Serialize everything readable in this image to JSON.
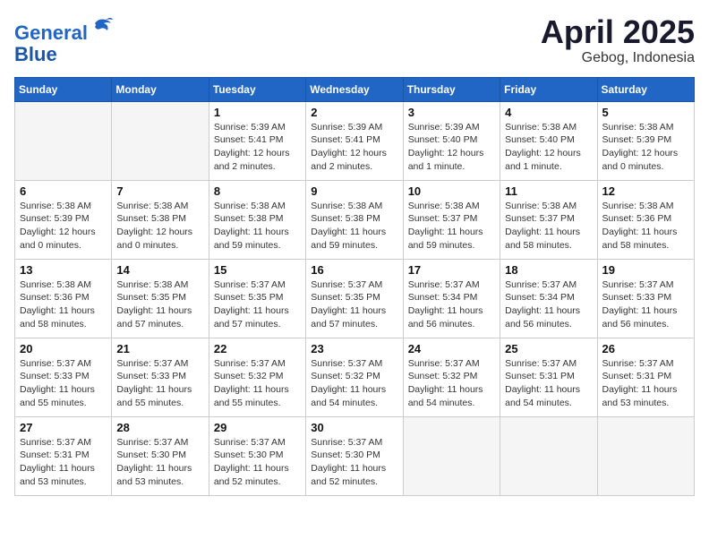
{
  "header": {
    "logo_line1": "General",
    "logo_line2": "Blue",
    "month": "April 2025",
    "location": "Gebog, Indonesia"
  },
  "weekdays": [
    "Sunday",
    "Monday",
    "Tuesday",
    "Wednesday",
    "Thursday",
    "Friday",
    "Saturday"
  ],
  "weeks": [
    [
      {
        "day": "",
        "info": ""
      },
      {
        "day": "",
        "info": ""
      },
      {
        "day": "1",
        "info": "Sunrise: 5:39 AM\nSunset: 5:41 PM\nDaylight: 12 hours\nand 2 minutes."
      },
      {
        "day": "2",
        "info": "Sunrise: 5:39 AM\nSunset: 5:41 PM\nDaylight: 12 hours\nand 2 minutes."
      },
      {
        "day": "3",
        "info": "Sunrise: 5:39 AM\nSunset: 5:40 PM\nDaylight: 12 hours\nand 1 minute."
      },
      {
        "day": "4",
        "info": "Sunrise: 5:38 AM\nSunset: 5:40 PM\nDaylight: 12 hours\nand 1 minute."
      },
      {
        "day": "5",
        "info": "Sunrise: 5:38 AM\nSunset: 5:39 PM\nDaylight: 12 hours\nand 0 minutes."
      }
    ],
    [
      {
        "day": "6",
        "info": "Sunrise: 5:38 AM\nSunset: 5:39 PM\nDaylight: 12 hours\nand 0 minutes."
      },
      {
        "day": "7",
        "info": "Sunrise: 5:38 AM\nSunset: 5:38 PM\nDaylight: 12 hours\nand 0 minutes."
      },
      {
        "day": "8",
        "info": "Sunrise: 5:38 AM\nSunset: 5:38 PM\nDaylight: 11 hours\nand 59 minutes."
      },
      {
        "day": "9",
        "info": "Sunrise: 5:38 AM\nSunset: 5:38 PM\nDaylight: 11 hours\nand 59 minutes."
      },
      {
        "day": "10",
        "info": "Sunrise: 5:38 AM\nSunset: 5:37 PM\nDaylight: 11 hours\nand 59 minutes."
      },
      {
        "day": "11",
        "info": "Sunrise: 5:38 AM\nSunset: 5:37 PM\nDaylight: 11 hours\nand 58 minutes."
      },
      {
        "day": "12",
        "info": "Sunrise: 5:38 AM\nSunset: 5:36 PM\nDaylight: 11 hours\nand 58 minutes."
      }
    ],
    [
      {
        "day": "13",
        "info": "Sunrise: 5:38 AM\nSunset: 5:36 PM\nDaylight: 11 hours\nand 58 minutes."
      },
      {
        "day": "14",
        "info": "Sunrise: 5:38 AM\nSunset: 5:35 PM\nDaylight: 11 hours\nand 57 minutes."
      },
      {
        "day": "15",
        "info": "Sunrise: 5:37 AM\nSunset: 5:35 PM\nDaylight: 11 hours\nand 57 minutes."
      },
      {
        "day": "16",
        "info": "Sunrise: 5:37 AM\nSunset: 5:35 PM\nDaylight: 11 hours\nand 57 minutes."
      },
      {
        "day": "17",
        "info": "Sunrise: 5:37 AM\nSunset: 5:34 PM\nDaylight: 11 hours\nand 56 minutes."
      },
      {
        "day": "18",
        "info": "Sunrise: 5:37 AM\nSunset: 5:34 PM\nDaylight: 11 hours\nand 56 minutes."
      },
      {
        "day": "19",
        "info": "Sunrise: 5:37 AM\nSunset: 5:33 PM\nDaylight: 11 hours\nand 56 minutes."
      }
    ],
    [
      {
        "day": "20",
        "info": "Sunrise: 5:37 AM\nSunset: 5:33 PM\nDaylight: 11 hours\nand 55 minutes."
      },
      {
        "day": "21",
        "info": "Sunrise: 5:37 AM\nSunset: 5:33 PM\nDaylight: 11 hours\nand 55 minutes."
      },
      {
        "day": "22",
        "info": "Sunrise: 5:37 AM\nSunset: 5:32 PM\nDaylight: 11 hours\nand 55 minutes."
      },
      {
        "day": "23",
        "info": "Sunrise: 5:37 AM\nSunset: 5:32 PM\nDaylight: 11 hours\nand 54 minutes."
      },
      {
        "day": "24",
        "info": "Sunrise: 5:37 AM\nSunset: 5:32 PM\nDaylight: 11 hours\nand 54 minutes."
      },
      {
        "day": "25",
        "info": "Sunrise: 5:37 AM\nSunset: 5:31 PM\nDaylight: 11 hours\nand 54 minutes."
      },
      {
        "day": "26",
        "info": "Sunrise: 5:37 AM\nSunset: 5:31 PM\nDaylight: 11 hours\nand 53 minutes."
      }
    ],
    [
      {
        "day": "27",
        "info": "Sunrise: 5:37 AM\nSunset: 5:31 PM\nDaylight: 11 hours\nand 53 minutes."
      },
      {
        "day": "28",
        "info": "Sunrise: 5:37 AM\nSunset: 5:30 PM\nDaylight: 11 hours\nand 53 minutes."
      },
      {
        "day": "29",
        "info": "Sunrise: 5:37 AM\nSunset: 5:30 PM\nDaylight: 11 hours\nand 52 minutes."
      },
      {
        "day": "30",
        "info": "Sunrise: 5:37 AM\nSunset: 5:30 PM\nDaylight: 11 hours\nand 52 minutes."
      },
      {
        "day": "",
        "info": ""
      },
      {
        "day": "",
        "info": ""
      },
      {
        "day": "",
        "info": ""
      }
    ]
  ]
}
